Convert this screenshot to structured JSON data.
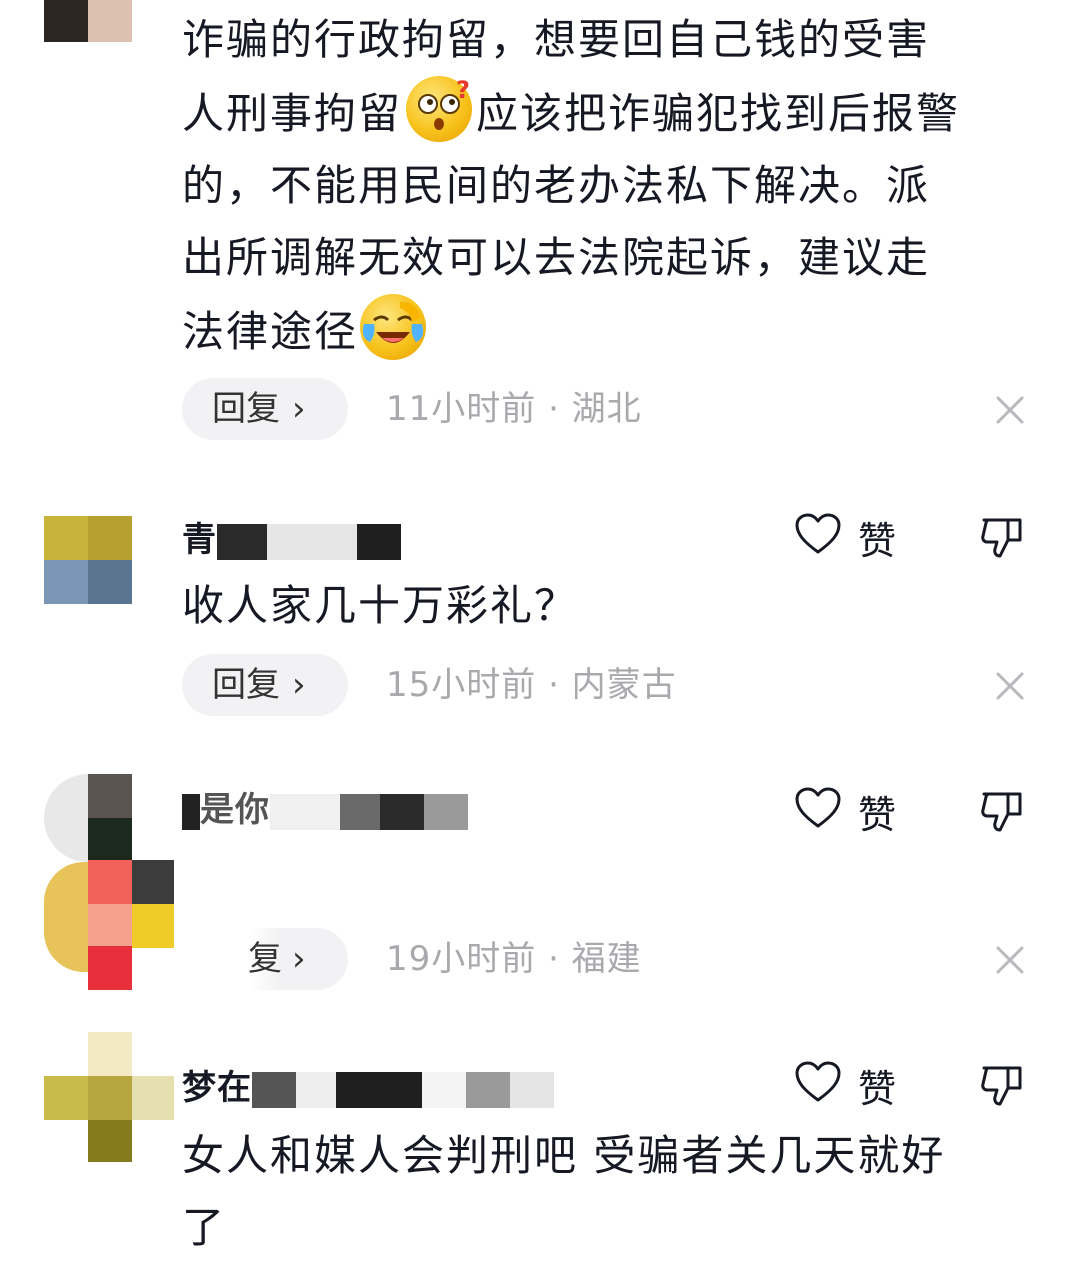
{
  "comments": [
    {
      "text_lines": [
        "诈骗的行政拘留，想要回自己钱的受害",
        "人刑事拘留",
        "应该把诈骗犯找到后报警",
        "的，不能用民间的老办法私下解决。派",
        "出所调解无效可以去法院起诉，建议走",
        "法律途径"
      ],
      "reply_label": "回复",
      "meta": "11小时前 · 湖北"
    },
    {
      "username_visible": "青",
      "text": "收人家几十万彩礼？",
      "like_label": "赞",
      "reply_label": "回复",
      "meta": "15小时前 · 内蒙古"
    },
    {
      "username_visible": "是你",
      "like_label": "赞",
      "reply_label": "复",
      "meta": "19小时前 · 福建"
    },
    {
      "username_visible": "梦在",
      "text_lines": [
        "女人和媒人会判刑吧 受骗者关几天就好",
        "了"
      ],
      "like_label": "赞"
    }
  ],
  "icons": {
    "chevron": "›",
    "close": "close-icon",
    "heart": "heart-outline-icon",
    "dislike": "thumbs-down-icon",
    "emoji_1": "confused-face-emoji",
    "emoji_2": "laughing-crying-face-emoji"
  },
  "colors": {
    "text": "#161823",
    "meta": "#a8a8ad",
    "pill_bg": "#f2f2f4"
  }
}
